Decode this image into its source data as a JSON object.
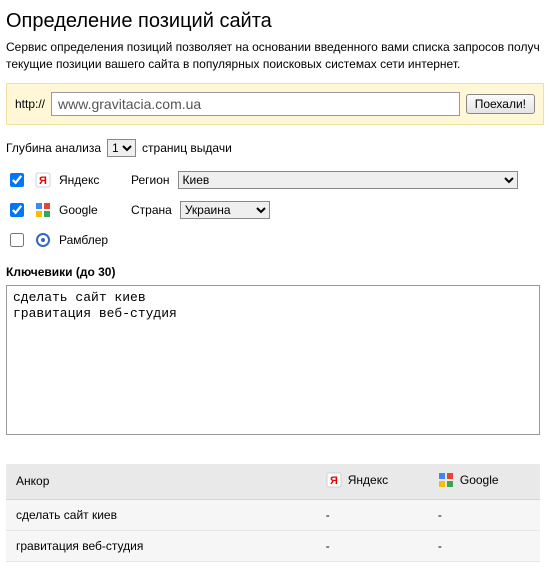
{
  "heading": "Определение позиций сайта",
  "intro": "Сервис определения позиций позволяет на основании введенного вами списка запросов получ текущие позиции вашего сайта в популярных поисковых системах сети интернет.",
  "url_bar": {
    "label": "http://",
    "value": "www.gravitacia.com.ua",
    "button": "Поехали!"
  },
  "depth": {
    "prefix": "Глубина анализа",
    "options": [
      "1"
    ],
    "selected": "1",
    "suffix": "страниц выдачи"
  },
  "engines": [
    {
      "key": "yandex",
      "checked": true,
      "name": "Яндекс",
      "field_label": "Регион",
      "field_options": [
        "Киев"
      ],
      "field_selected": "Киев",
      "field_class": "region-select"
    },
    {
      "key": "google",
      "checked": true,
      "name": "Google",
      "field_label": "Страна",
      "field_options": [
        "Украина"
      ],
      "field_selected": "Украина",
      "field_class": "country-select"
    },
    {
      "key": "rambler",
      "checked": false,
      "name": "Рамблер",
      "field_label": null
    }
  ],
  "keywords": {
    "label": "Ключевики (до 30)",
    "value": "сделать сайт киев\nгравитация веб-студия"
  },
  "results": {
    "columns": {
      "anchor": "Анкор",
      "yandex": "Яндекс",
      "google": "Google"
    },
    "rows": [
      {
        "anchor": "сделать сайт киев",
        "yandex": "-",
        "google": "-"
      },
      {
        "anchor": "гравитация веб-студия",
        "yandex": "-",
        "google": "-"
      }
    ]
  },
  "icons": {
    "yandex": "yandex-icon",
    "google": "google-icon",
    "rambler": "rambler-icon"
  }
}
